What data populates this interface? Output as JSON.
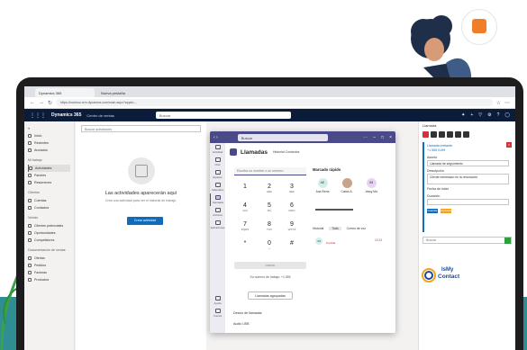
{
  "browser": {
    "tabs": [
      "Dynamics 365",
      "Nueva pestaña"
    ],
    "url": "https://contoso.crm.dynamics.com/main.aspx?appid=..."
  },
  "appbar": {
    "brand": "Dynamics 365",
    "area": "Centro de ventas",
    "search_placeholder": "Buscar"
  },
  "sidebar": {
    "items_top": [
      "Inicio",
      "Recientes",
      "Anclados"
    ],
    "group_mi_trabajo": "Mi trabajo",
    "items_trabajo": [
      "Actividades",
      "Paneles",
      "Resúmenes"
    ],
    "group_clientes": "Clientes",
    "items_clientes": [
      "Cuentas",
      "Contactos"
    ],
    "group_ventas": "Ventas",
    "items_ventas": [
      "Clientes potenciales",
      "Oportunidades",
      "Competidores"
    ],
    "group_garantias": "Documentación de ventas",
    "items_garantias": [
      "Ofertas",
      "Pedidos",
      "Facturas",
      "Productos"
    ]
  },
  "activity": {
    "search_placeholder": "Buscar actividades",
    "title": "Las actividades aparecerán aquí",
    "subtitle": "Crea una actividad para ver el historial de trabajo.",
    "button": "Crear actividad"
  },
  "teams": {
    "search": "Buscar",
    "title": "Llamadas",
    "subtitle": "Historial  Contactos",
    "dial_placeholder": "Escriba un nombre o un número",
    "keys": [
      {
        "n": "1",
        "l": ""
      },
      {
        "n": "2",
        "l": "ABC"
      },
      {
        "n": "3",
        "l": "DEF"
      },
      {
        "n": "4",
        "l": "GHI"
      },
      {
        "n": "5",
        "l": "JKL"
      },
      {
        "n": "6",
        "l": "MNO"
      },
      {
        "n": "7",
        "l": "PQRS"
      },
      {
        "n": "8",
        "l": "TUV"
      },
      {
        "n": "9",
        "l": "WXYZ"
      },
      {
        "n": "*",
        "l": ""
      },
      {
        "n": "0",
        "l": "+"
      },
      {
        "n": "#",
        "l": ""
      }
    ],
    "call_button": "Llamar",
    "work_number": "Su número de trabajo: +1 555",
    "call_forwarding": "Llamadas agrupadas",
    "footer_1": "Desvío de llamadas",
    "footer_2": "Audio USB",
    "quick_dial_title": "Marcado rápido",
    "quick_dial": [
      {
        "initials": "AE",
        "name": "Ana Elena",
        "color": "#d4efe9"
      },
      {
        "initials": "",
        "name": "Carlos A.",
        "color": "#c8a48a"
      },
      {
        "initials": "JM",
        "name": "Jessy Ma",
        "color": "#e8d4f0"
      }
    ],
    "history_tabs": [
      "Historial",
      "Todo",
      "Correo de voz"
    ],
    "history": {
      "initials": "JM",
      "name": "Perdida",
      "time": "10:23"
    },
    "rail": [
      "Actividad",
      "Chat",
      "Equipos",
      "Calendario",
      "Llamadas",
      "Archivos",
      "Aplicaciones"
    ],
    "rail_bottom": [
      "Ayuda",
      "Cuenta"
    ]
  },
  "rpanel": {
    "title": "Llamada",
    "card_line1": "Llamada entrante",
    "card_line2": "+1 555 0199",
    "label_asunto": "Asunto",
    "asunto": "Llamada de seguimiento",
    "label_descripcion": "Descripción",
    "descripcion": "Cliente interesado en la renovación",
    "label_fecha": "Fecha de inicio",
    "label_duracion": "Duración",
    "btn_save": "Guardar",
    "btn_cancel": "Cancelar",
    "input_placeholder": "Buscar"
  },
  "logo": {
    "line1": "IsMy",
    "line2": "Contact"
  }
}
